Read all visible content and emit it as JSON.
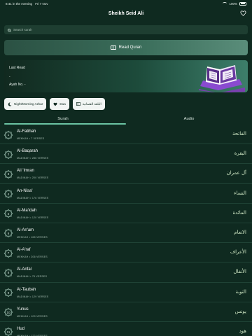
{
  "status_bar": {
    "time": "8:41 in the evening",
    "date": "Fri 7 Nov",
    "battery": "100%"
  },
  "header": {
    "title": "Sheikh Seid Ali"
  },
  "search": {
    "placeholder": "Search surah"
  },
  "read_button": {
    "label": "Read Quran"
  },
  "last_read": {
    "label": "Last Read",
    "surah": "-",
    "ayah": "Ayah No. -"
  },
  "chips": [
    {
      "label": "Night/Morning Azkar",
      "icon": "moon-icon"
    },
    {
      "label": "Dua",
      "icon": "heart-icon"
    },
    {
      "label": "البلغة العثمانية",
      "icon": "book-icon"
    }
  ],
  "tabs": [
    {
      "label": "Surah"
    },
    {
      "label": "Audio"
    }
  ],
  "surahs": [
    {
      "number": "1",
      "name": "Al-Fatihah",
      "meta": "MEKKAH • 7 VERSES",
      "arabic": "الفاتحة"
    },
    {
      "number": "2",
      "name": "Al-Baqarah",
      "meta": "MADINAH • 286 VERSES",
      "arabic": "البقرة"
    },
    {
      "number": "3",
      "name": "Ali 'Imran",
      "meta": "MADINAH • 200 VERSES",
      "arabic": "آل عمران"
    },
    {
      "number": "4",
      "name": "An-Nisa'",
      "meta": "MADINAH • 176 VERSES",
      "arabic": "النساء"
    },
    {
      "number": "5",
      "name": "Al-Ma'idah",
      "meta": "MADINAH • 120 VERSES",
      "arabic": "المائدة"
    },
    {
      "number": "6",
      "name": "Al-An'am",
      "meta": "MEKKAH • 165 VERSES",
      "arabic": "الانعام"
    },
    {
      "number": "7",
      "name": "Al-A'raf",
      "meta": "MEKKAH • 206 VERSES",
      "arabic": "الأعراف"
    },
    {
      "number": "8",
      "name": "Al-Anfal",
      "meta": "MADINAH • 75 VERSES",
      "arabic": "الأنفال"
    },
    {
      "number": "9",
      "name": "At-Taubah",
      "meta": "MADINAH • 129 VERSES",
      "arabic": "التوبة"
    },
    {
      "number": "10",
      "name": "Yunus",
      "meta": "MEKKAH • 109 VERSES",
      "arabic": "يونس"
    },
    {
      "number": "11",
      "name": "Hud",
      "meta": "MEKKAH • 123 VERSES",
      "arabic": "هود"
    }
  ],
  "colors": {
    "background": "#0f2a20",
    "accent": "#6bc4a3",
    "chip_background": "#f1f5f3"
  }
}
